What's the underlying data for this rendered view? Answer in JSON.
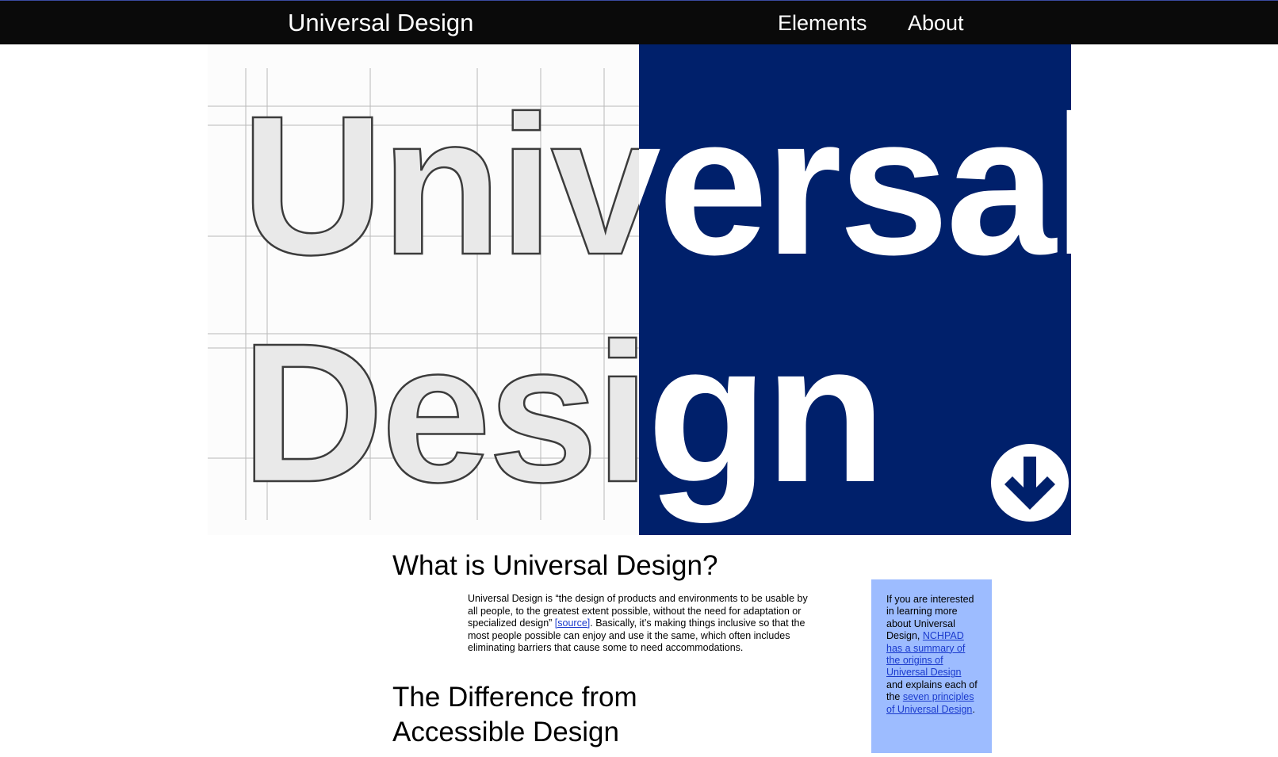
{
  "nav": {
    "site_title": "Universal Design",
    "links": [
      {
        "label": "Elements"
      },
      {
        "label": "About"
      }
    ]
  },
  "hero": {
    "line1": "Universal",
    "line2": "Design",
    "panel_color": "#00206b",
    "arrow_icon": "arrow-down-circle-icon"
  },
  "section1": {
    "heading": "What is Universal Design?",
    "text_before_link": "Universal Design is “the design of products and environments to be usable by all people, to the greatest extent possible, without the need for adaptation or specialized design” ",
    "link_label": "[source]",
    "text_after_link": ". Basically, it’s making things inclusive so that the most people possible can enjoy and use it the same, which often includes eliminating barriers that cause some to need accommodations."
  },
  "section2": {
    "heading": "The Difference from Accessible Design"
  },
  "sidebar": {
    "text1": "If you are interested in learning more about Universal Design, ",
    "link1": "NCHPAD has a summary of the origins of Universal Design",
    "text2": " and explains each of the ",
    "link2": "seven principles of Universal Design",
    "text3": ".",
    "background": "#9dbcff"
  },
  "colors": {
    "topbar": "#0a0a0a",
    "link": "#1a3acd"
  }
}
